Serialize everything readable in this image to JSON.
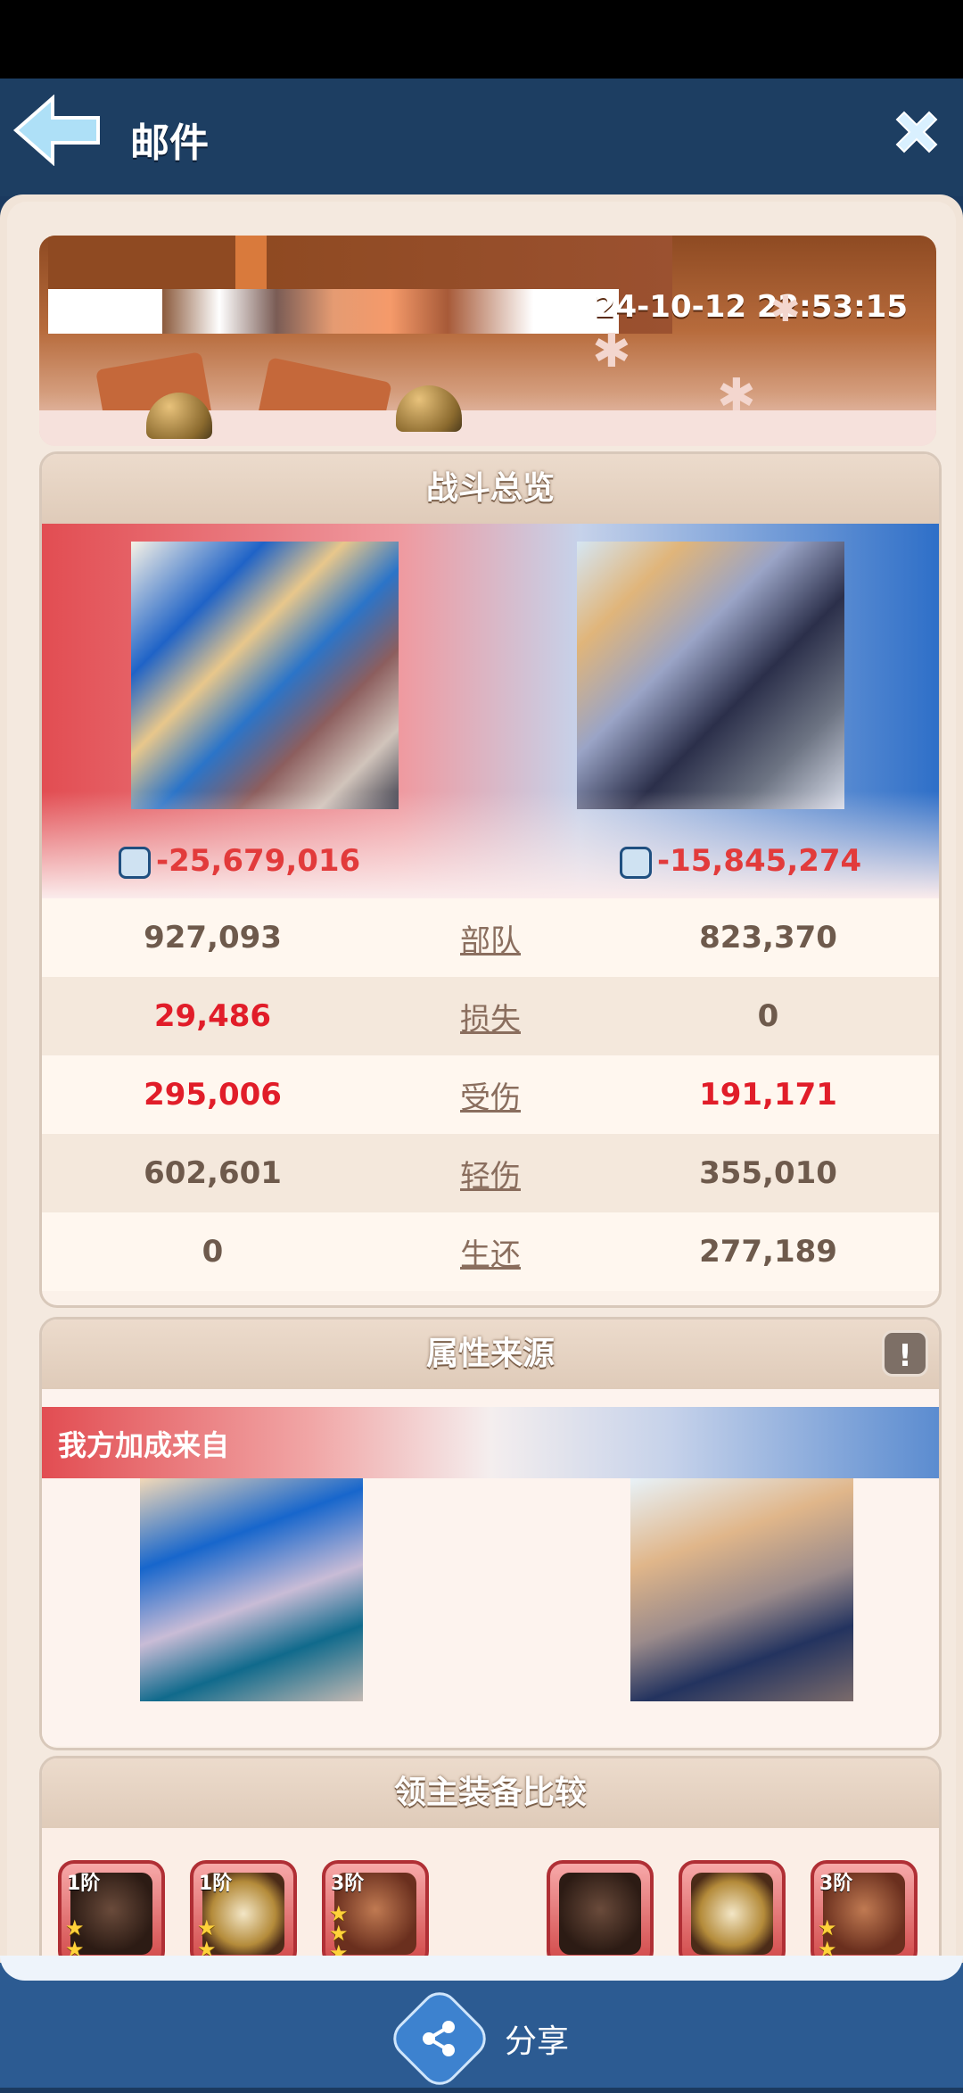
{
  "header": {
    "title": "邮件"
  },
  "banner": {
    "datetime": "24-10-12 22:53:15"
  },
  "battle": {
    "section_title": "战斗总览",
    "left_power": "-25,679,016",
    "right_power": "-15,845,274",
    "rows": [
      {
        "label": "部队",
        "left": "927,093",
        "right": "823,370",
        "left_red": false,
        "right_red": false
      },
      {
        "label": "损失",
        "left": "29,486",
        "right": "0",
        "left_red": true,
        "right_red": false
      },
      {
        "label": "受伤",
        "left": "295,006",
        "right": "191,171",
        "left_red": true,
        "right_red": true
      },
      {
        "label": "轻伤",
        "left": "602,601",
        "right": "355,010",
        "left_red": false,
        "right_red": false
      },
      {
        "label": "生还",
        "left": "0",
        "right": "277,189",
        "left_red": false,
        "right_red": false
      }
    ]
  },
  "attributes": {
    "section_title": "属性来源",
    "our_bonus_label": "我方加成来自",
    "info_glyph": "!"
  },
  "equipment": {
    "section_title": "领主装备比较",
    "left_items": [
      {
        "tier": "1阶",
        "stars": 2
      },
      {
        "tier": "1阶",
        "stars": 2
      },
      {
        "tier": "3阶",
        "stars": 3
      }
    ],
    "right_items": [
      {
        "tier": "",
        "stars": 0
      },
      {
        "tier": "",
        "stars": 0
      },
      {
        "tier": "3阶",
        "stars": 2
      }
    ]
  },
  "footer": {
    "share_label": "分享"
  },
  "colors": {
    "accent_red": "#e11d29",
    "header_blue": "#1d3e62",
    "panel_beige": "#f1e4d8"
  }
}
